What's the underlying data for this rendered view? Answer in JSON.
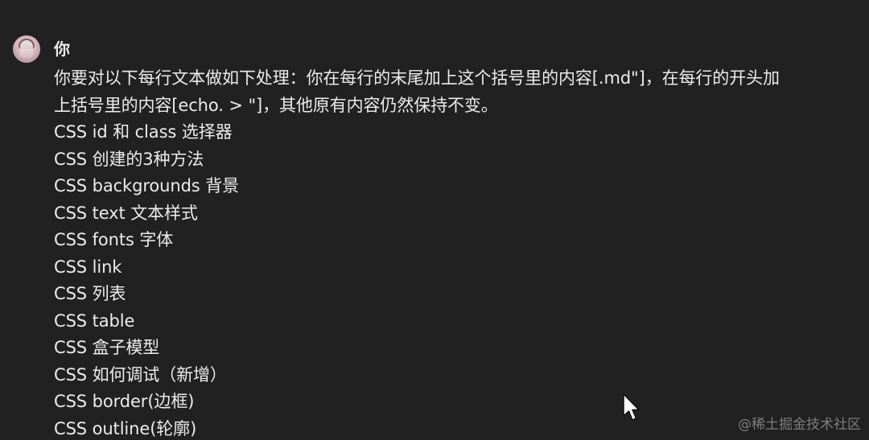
{
  "message": {
    "author": "你",
    "prompt_lines": [
      "你要对以下每行文本做如下处理：你在每行的末尾加上这个括号里的内容[.md\"]，在每行的开头加",
      "上括号里的内容[echo. > \"]，其他原有内容仍然保持不变。"
    ],
    "items": [
      "CSS id 和 class 选择器",
      "CSS 创建的3种方法",
      "CSS backgrounds 背景",
      "CSS text 文本样式",
      "CSS fonts 字体",
      "CSS link",
      "CSS 列表",
      "CSS table",
      "CSS 盒子模型",
      "CSS 如何调试（新增）",
      "CSS border(边框)",
      "CSS outline(轮廓)"
    ]
  },
  "watermark": "@稀土掘金技术社区",
  "icons": {
    "avatar": "user-avatar",
    "cursor": "mouse-pointer-icon"
  }
}
